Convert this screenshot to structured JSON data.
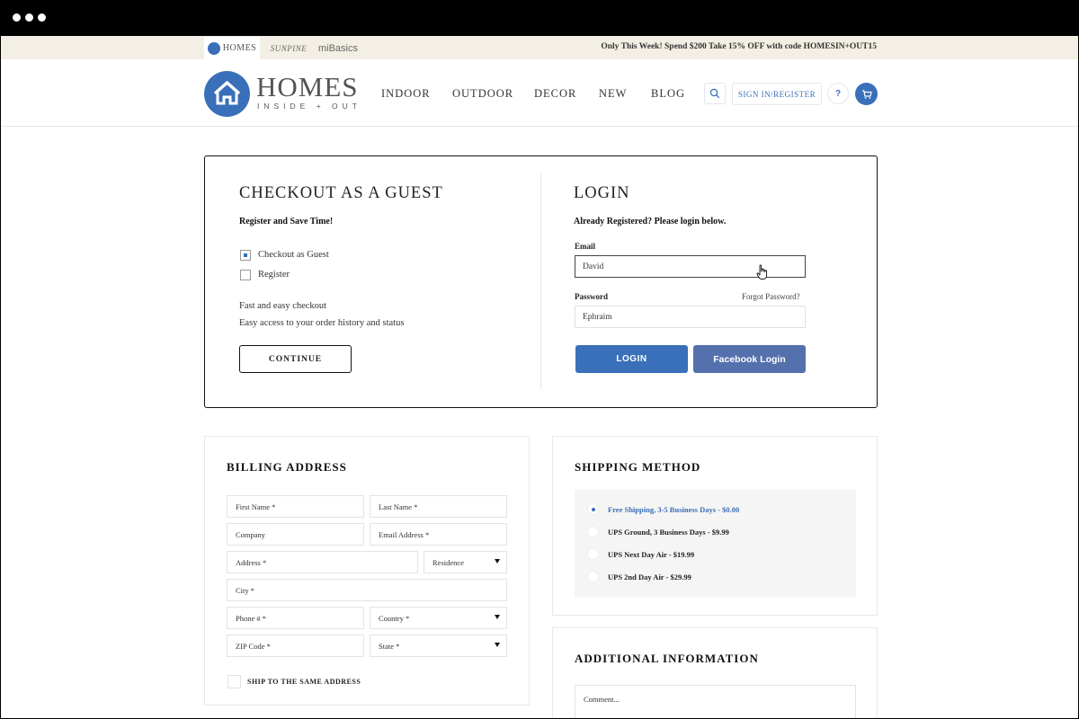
{
  "window_controls": [
    "dot",
    "dot",
    "dot"
  ],
  "topbar": {
    "brands": [
      {
        "text": "HOMES",
        "icon": "homes-logo-icon"
      },
      {
        "text": "SUNPINE"
      },
      {
        "text": "miBasics"
      }
    ],
    "promo": "Only This Week! Spend $200 Take 15% OFF with code HOMESIN+OUT15"
  },
  "header": {
    "logo_main": "HOMES",
    "logo_sub": "INSIDE + OUT",
    "nav": [
      "INDOOR",
      "OUTDOOR",
      "DECOR",
      "NEW",
      "BLOG"
    ],
    "signin_label": "SIGN IN/REGISTER",
    "help_label": "?",
    "icons": {
      "search": "search-icon",
      "cart": "cart-icon",
      "logo": "house-icon"
    }
  },
  "guest": {
    "title": "CHECKOUT AS A GUEST",
    "subtitle": "Register and Save Time!",
    "options": [
      {
        "label": "Checkout as Guest",
        "checked": true
      },
      {
        "label": "Register",
        "checked": false
      }
    ],
    "benefits": [
      "Fast and easy checkout",
      "Easy access to your order history and status"
    ],
    "continue_label": "CONTINUE"
  },
  "login": {
    "title": "LOGIN",
    "subtitle": "Already Registered? Please login below.",
    "email_label": "Email",
    "email_value": "David",
    "password_label": "Password",
    "forgot_label": "Forgot Password?",
    "password_value": "Ephraim",
    "login_label": "LOGIN",
    "facebook_label": "Facebook Login",
    "colors": {
      "login": "#3a6fb9",
      "facebook": "#5470ad"
    }
  },
  "billing": {
    "title": "BILLING ADDRESS",
    "fields": {
      "first_name": "First Name *",
      "last_name": "Last Name *",
      "company": "Company",
      "email": "Email Address *",
      "address": "Address *",
      "residence": "Residence",
      "city": "City *",
      "phone": "Phone # *",
      "country": "Country *",
      "zip": "ZIP Code *",
      "state": "State *"
    },
    "same_address_label": "SHIP TO THE SAME ADDRESS"
  },
  "shipping": {
    "title": "SHIPPING METHOD",
    "options": [
      {
        "label": "Free Shipping, 3-5 Business Days - $0.00",
        "selected": true
      },
      {
        "label": "UPS Ground, 3 Business Days - $9.99",
        "selected": false
      },
      {
        "label": "UPS Next Day Air - $19.99",
        "selected": false
      },
      {
        "label": "UPS 2nd Day Air - $29.99",
        "selected": false
      }
    ]
  },
  "additional": {
    "title": "ADDITIONAL INFORMATION",
    "comment_placeholder": "Comment..."
  },
  "accent_color": "#3a6fb9"
}
